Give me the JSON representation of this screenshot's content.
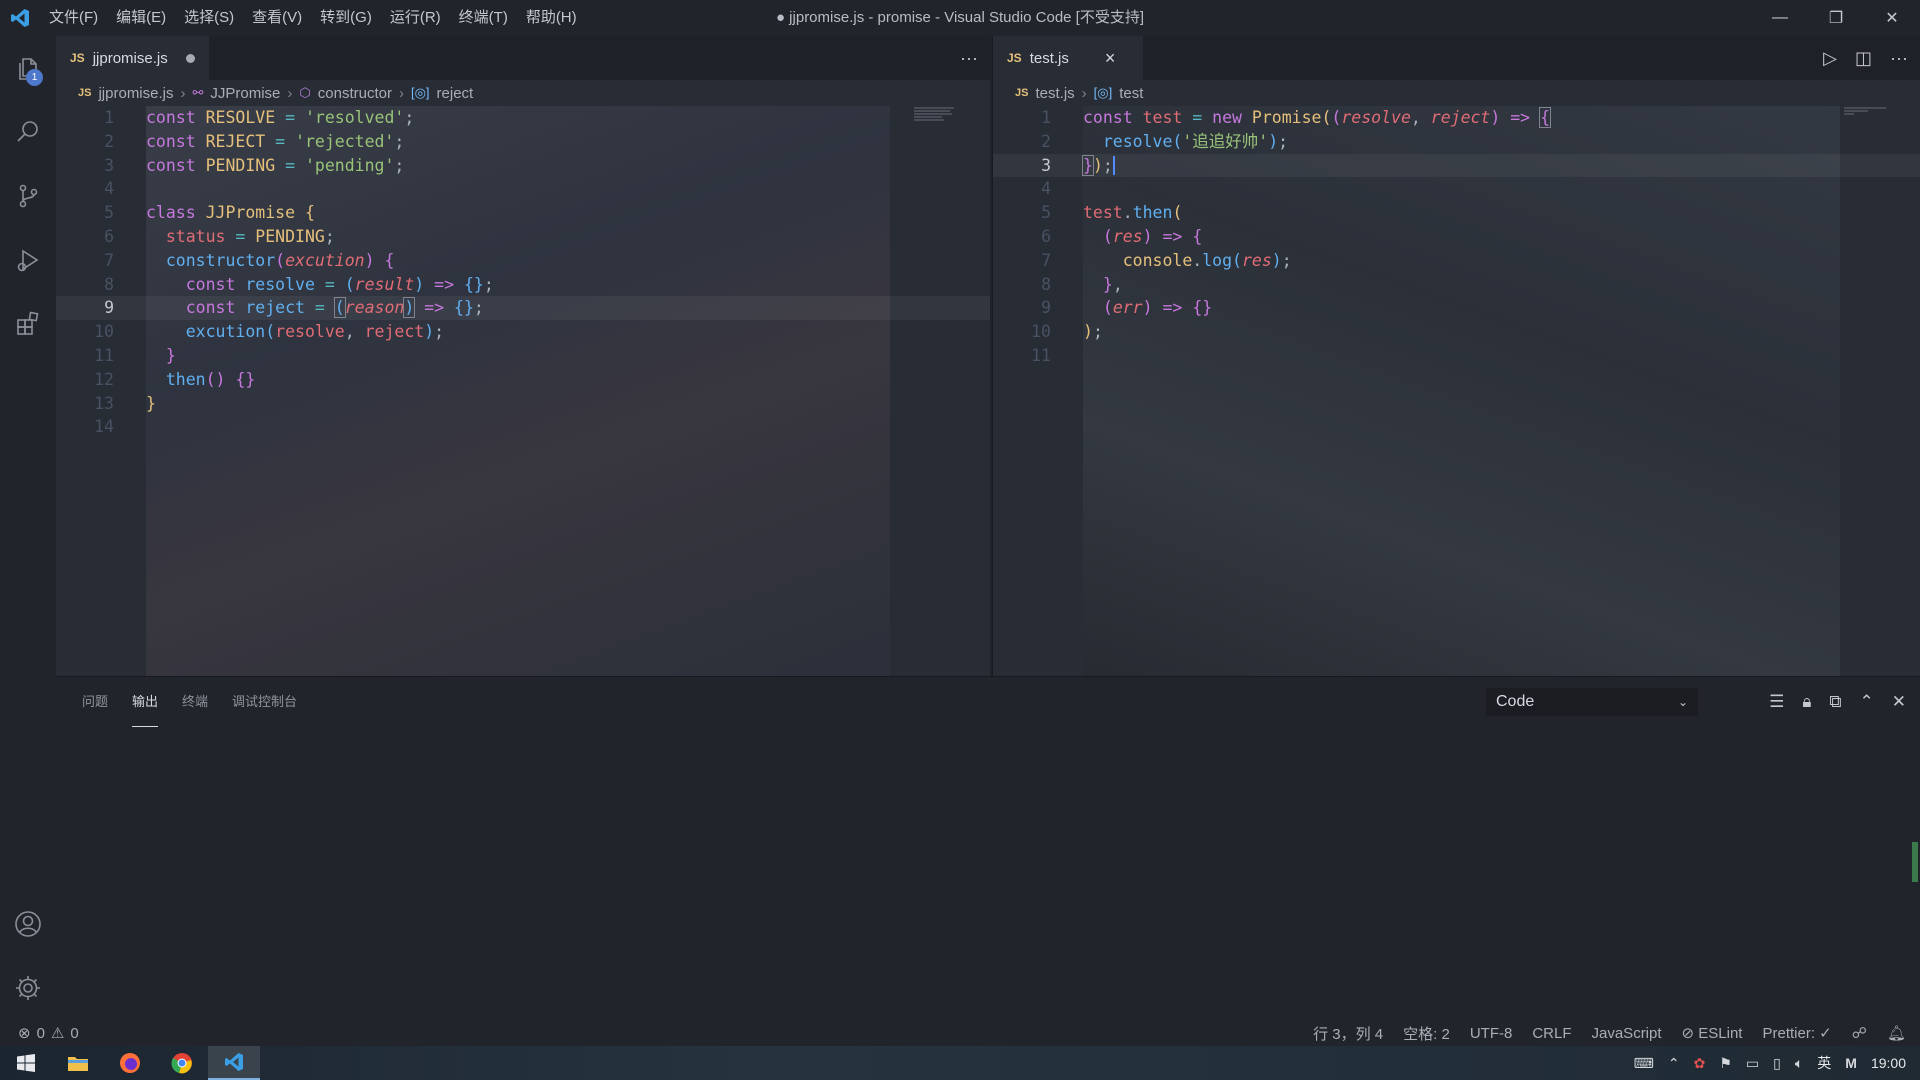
{
  "titlebar": {
    "menus": [
      "文件(F)",
      "编辑(E)",
      "选择(S)",
      "查看(V)",
      "转到(G)",
      "运行(R)",
      "终端(T)",
      "帮助(H)"
    ],
    "window_title": "● jjpromise.js - promise - Visual Studio Code [不受支持]"
  },
  "activity": {
    "explorer_badge": "1"
  },
  "left_editor": {
    "tab_label": "jjpromise.js",
    "tab_lang": "JS",
    "breadcrumbs": [
      "jjpromise.js",
      "JJPromise",
      "constructor",
      "reject"
    ]
  },
  "right_editor": {
    "tab_label": "test.js",
    "tab_lang": "JS",
    "breadcrumbs": [
      "test.js",
      "test"
    ]
  },
  "panel": {
    "tabs": [
      "问题",
      "输出",
      "终端",
      "调试控制台"
    ],
    "active_tab": "输出",
    "output_channel": "Code"
  },
  "status": {
    "errors": "0",
    "warnings": "0",
    "cursor": "行 3，列 4",
    "spaces": "空格: 2",
    "encoding": "UTF-8",
    "eol": "CRLF",
    "language": "JavaScript",
    "eslint": "ESLint",
    "prettier": "Prettier: ✓"
  },
  "taskbar": {
    "ime": "英",
    "clock": "19:00"
  },
  "colors": {
    "accent": "#4d78cc",
    "keyword": "#c678dd",
    "string": "#98c379",
    "function": "#61afef",
    "variable": "#e06c75",
    "class": "#e5c07b"
  }
}
